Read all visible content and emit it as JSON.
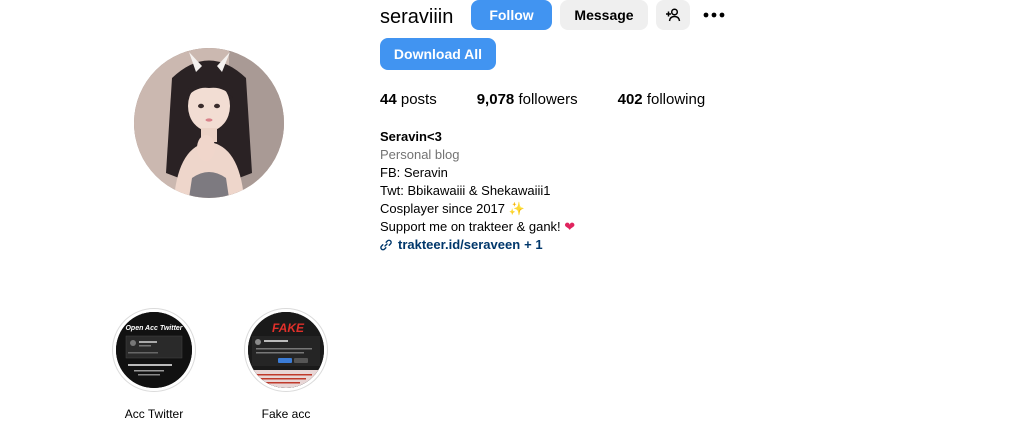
{
  "profile": {
    "username": "seraviiin",
    "display_name": "Seravin<3",
    "category": "Personal blog",
    "bio_lines": [
      "FB: Seravin",
      "Twt: Bbikawaiii & Shekawaiii1",
      "Cosplayer since 2017",
      "Support me on trakteer & gank!"
    ],
    "link": {
      "text": "trakteer.id/seraveen",
      "extra": "+ 1"
    }
  },
  "actions": {
    "follow_label": "Follow",
    "message_label": "Message",
    "download_label": "Download All"
  },
  "stats": {
    "posts_count": "44",
    "posts_label": "posts",
    "followers_count": "9,078",
    "followers_label": "followers",
    "following_count": "402",
    "following_label": "following"
  },
  "highlights": [
    {
      "label": "Acc Twitter",
      "cover_text": "Open Acc Twitter"
    },
    {
      "label": "Fake acc",
      "cover_text": "FAKE"
    }
  ],
  "icons": {
    "add_user": "add-user-icon",
    "more": "more-options-icon",
    "link": "link-icon",
    "sparkle": "sparkles-icon",
    "heart": "red-heart-icon"
  },
  "colors": {
    "primary_button": "#4194f1",
    "secondary_button": "#efefef",
    "link": "#00376b",
    "muted": "#737373"
  }
}
